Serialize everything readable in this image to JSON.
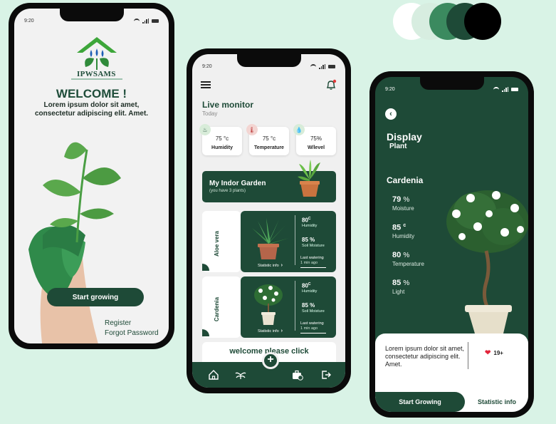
{
  "palette": [
    "#ffffff",
    "#d7ede0",
    "#3b8a5f",
    "#1e4a37",
    "#000000"
  ],
  "phone1": {
    "time": "9:20",
    "logo_text": "IPWSAMS",
    "welcome": "WELCOME !",
    "lorem": "Lorem ipsum dolor sit amet, consectetur adipiscing elit. Amet.",
    "start_button": "Start growing",
    "register": "Register",
    "forgot": "Forgot Password"
  },
  "phone2": {
    "time": "9:20",
    "title": "Live monitor",
    "subtitle": "Today",
    "metrics": [
      {
        "icon": "humidity-icon",
        "value": "75 °c",
        "label": "Humidity",
        "color": "#d8ecd9"
      },
      {
        "icon": "thermometer-icon",
        "value": "75 °c",
        "label": "Temperature",
        "color": "#f3d5d2"
      },
      {
        "icon": "water-drop-icon",
        "value": "75%",
        "label": "W/level",
        "color": "#d8ecd9"
      }
    ],
    "garden": {
      "title": "My Indor Garden",
      "subtitle": "(you have 3  plants)"
    },
    "plants": [
      {
        "name": "Aloe vera",
        "humidity": "80",
        "humidity_unit": "C",
        "humidity_label": "Humidity",
        "moisture": "85 %",
        "moisture_label": "Soil Moisture",
        "last_watering": "Last watering",
        "ago": "1 min ago",
        "stat": "Statistic info"
      },
      {
        "name": "Cardenia",
        "humidity": "80",
        "humidity_unit": "C",
        "humidity_label": "Humidity",
        "moisture": "85 %",
        "moisture_label": "Soil Moisture",
        "last_watering": "Last watering",
        "ago": "1 min ago",
        "stat": "Statistic info"
      }
    ],
    "welcome_please": "welcome please click",
    "fab": "+"
  },
  "phone3": {
    "time": "9:20",
    "display": "Display",
    "plant": "Plant",
    "name": "Cardenia",
    "stats": [
      {
        "value": "79",
        "unit": "%",
        "label": "Moisture"
      },
      {
        "value": "85",
        "unit": "c",
        "label": "Humidity"
      },
      {
        "value": "80",
        "unit": "%",
        "label": "Temperature"
      },
      {
        "value": "85",
        "unit": "%",
        "label": "Light"
      }
    ],
    "description": "Lorem ipsum dolor sit amet, consectetur adipiscing elit. Amet.",
    "likes": "19+",
    "start_button": "Start Growing",
    "stat_button": "Statistic info"
  }
}
